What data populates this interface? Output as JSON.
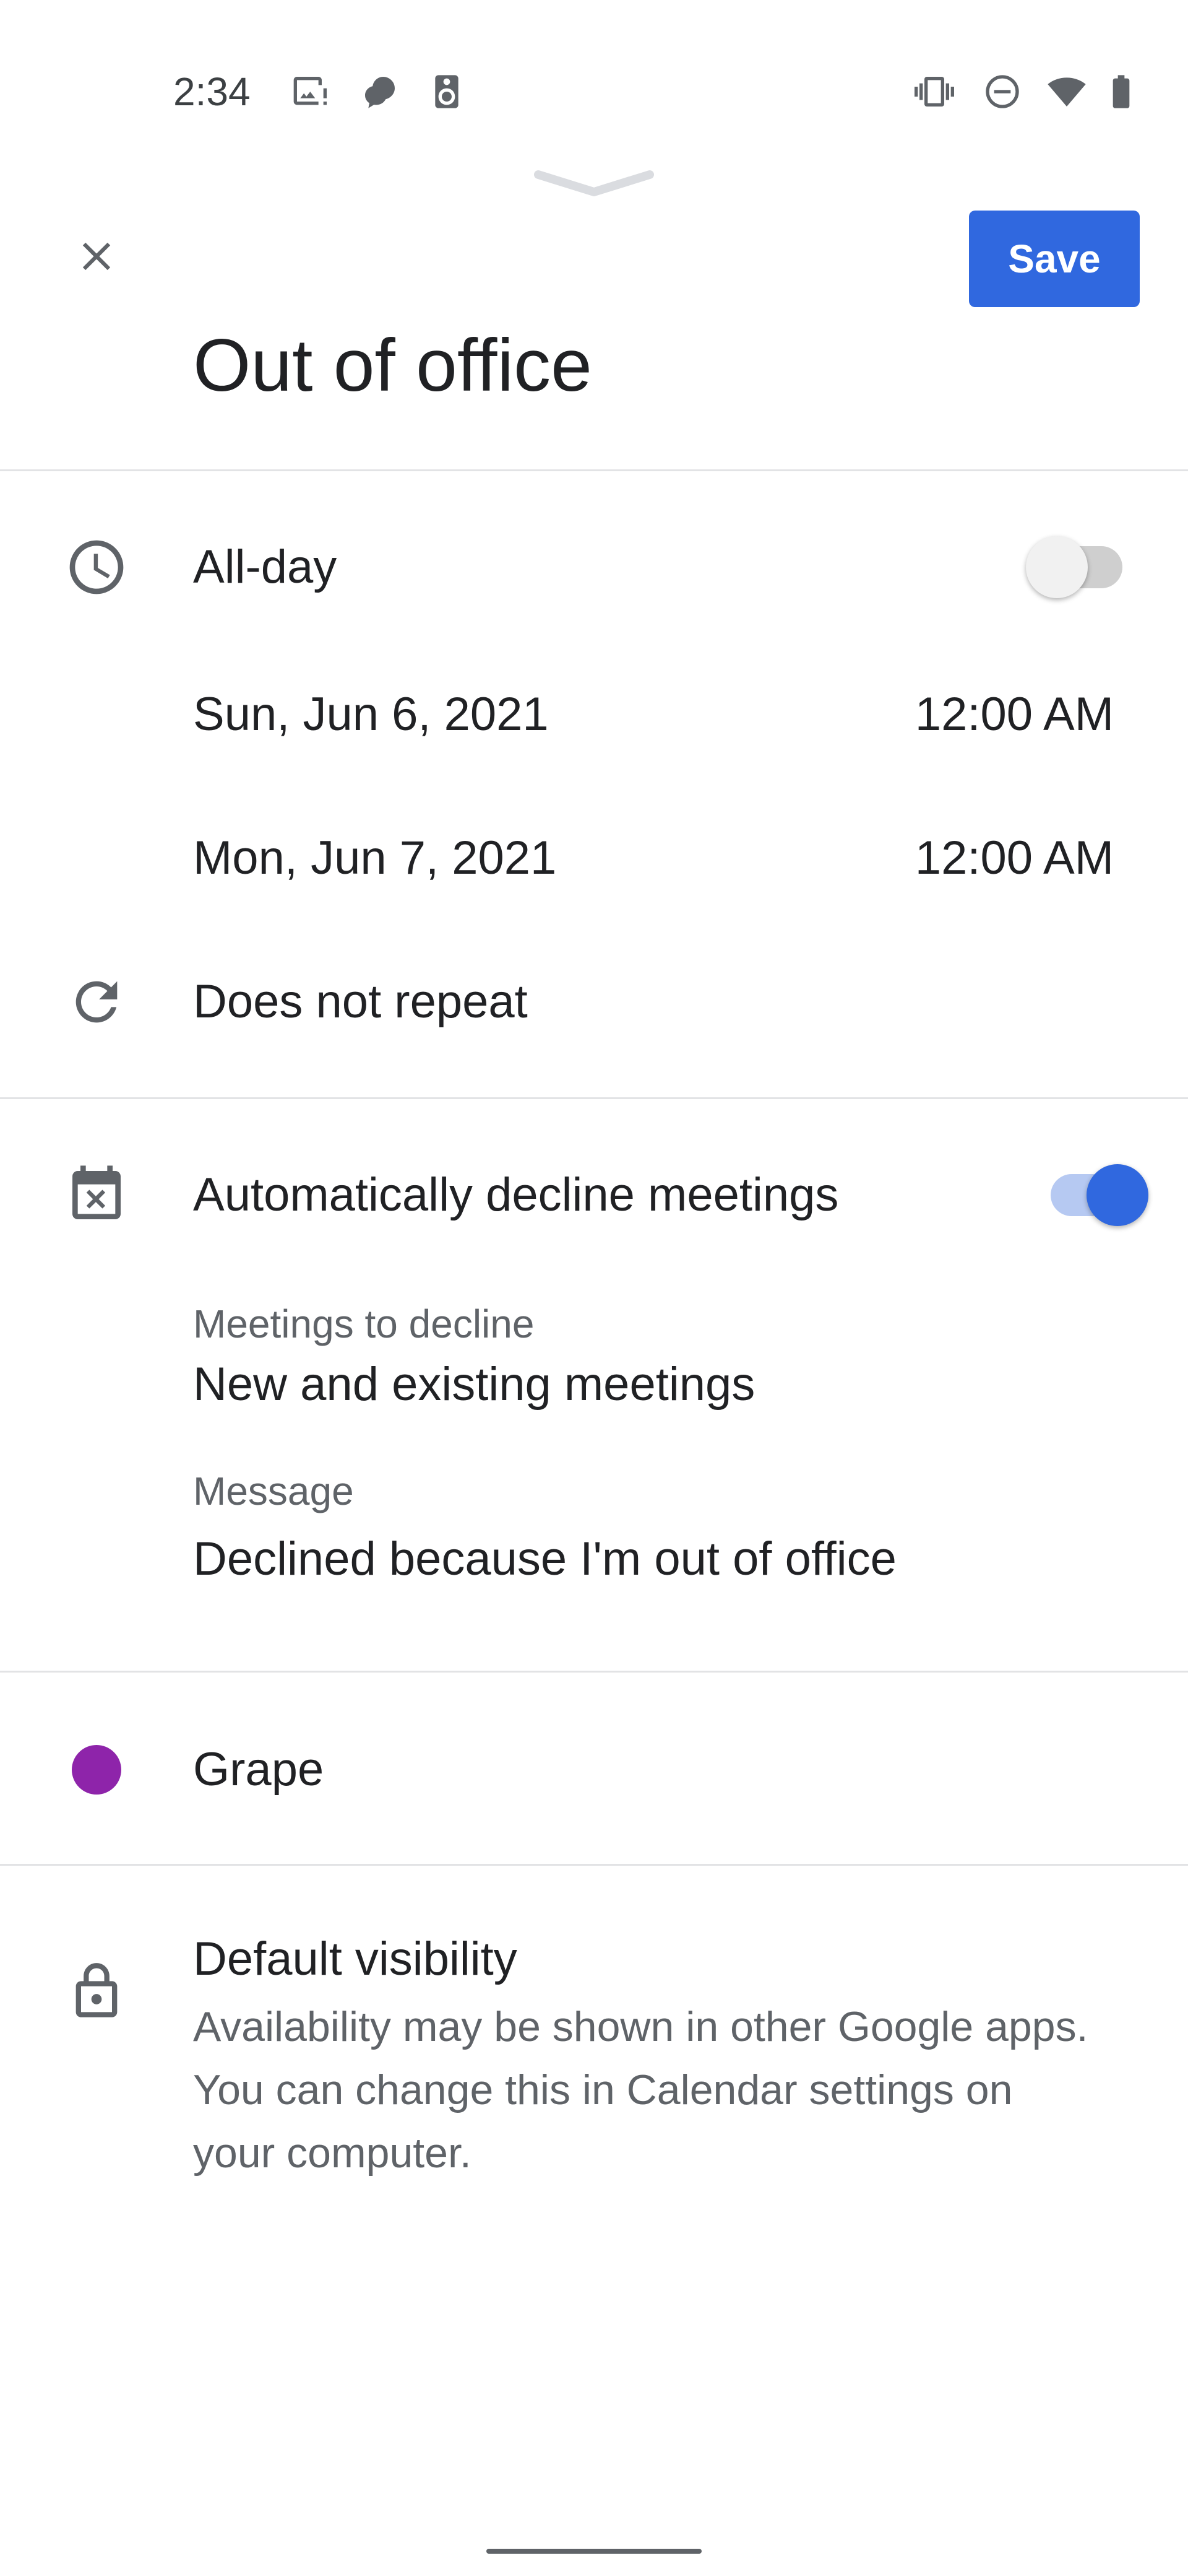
{
  "status_bar": {
    "time": "2:34",
    "left_icons": [
      "image-alert-icon",
      "assistant-icon",
      "speaker-icon"
    ],
    "right_icons": [
      "vibrate-icon",
      "do-not-disturb-icon",
      "wifi-icon",
      "battery-icon"
    ]
  },
  "header": {
    "close_icon": "close-icon",
    "save_label": "Save",
    "title": "Out of office"
  },
  "schedule": {
    "all_day_label": "All-day",
    "all_day_on": false,
    "start_date": "Sun, Jun 6, 2021",
    "start_time": "12:00 AM",
    "end_date": "Mon, Jun 7, 2021",
    "end_time": "12:00 AM",
    "repeat_label": "Does not repeat"
  },
  "decline": {
    "label": "Automatically decline meetings",
    "enabled": true,
    "meetings_label": "Meetings to decline",
    "meetings_value": "New and existing meetings",
    "message_label": "Message",
    "message_value": "Declined because I'm out of office"
  },
  "color": {
    "name": "Grape",
    "hex": "#8e24aa"
  },
  "visibility": {
    "title": "Default visibility",
    "line1": "Availability may be shown in other Google apps.",
    "line2": "You can change this in Calendar settings on",
    "line3": "your computer."
  },
  "colors": {
    "accent": "#3068df",
    "toggle_on_track": "#b6c9f2",
    "divider": "#e2e3e5"
  }
}
